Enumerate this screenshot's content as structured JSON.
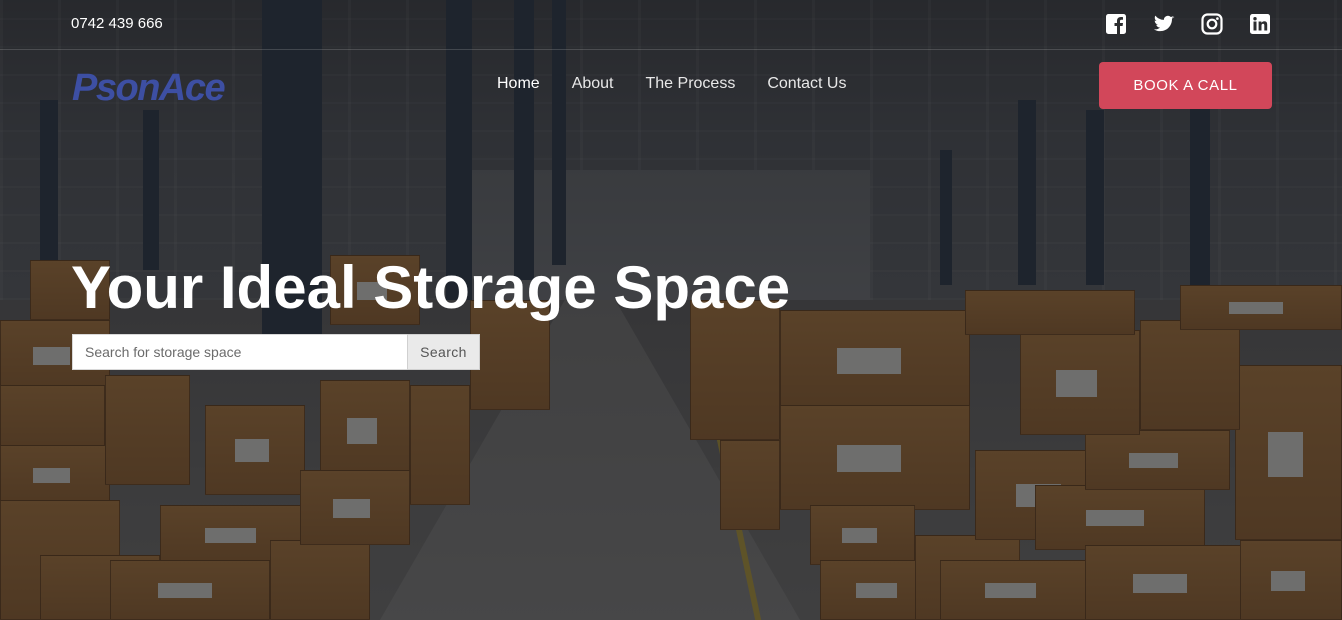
{
  "topbar": {
    "phone": "0742 439 666",
    "social": [
      {
        "icon": "facebook-icon"
      },
      {
        "icon": "twitter-icon"
      },
      {
        "icon": "instagram-icon"
      },
      {
        "icon": "linkedin-icon"
      }
    ]
  },
  "brand": {
    "logo_text": "PsonAce",
    "color": "#3d4fa3"
  },
  "nav": {
    "items": [
      {
        "label": "Home",
        "active": true
      },
      {
        "label": "About",
        "active": false
      },
      {
        "label": "The Process",
        "active": false
      },
      {
        "label": "Contact Us",
        "active": false
      }
    ],
    "cta_label": "BOOK A CALL",
    "cta_color": "#d2475a"
  },
  "hero": {
    "headline": "Your Ideal Storage Space",
    "search": {
      "placeholder": "Search for storage space",
      "value": "",
      "button_label": "Search"
    }
  }
}
